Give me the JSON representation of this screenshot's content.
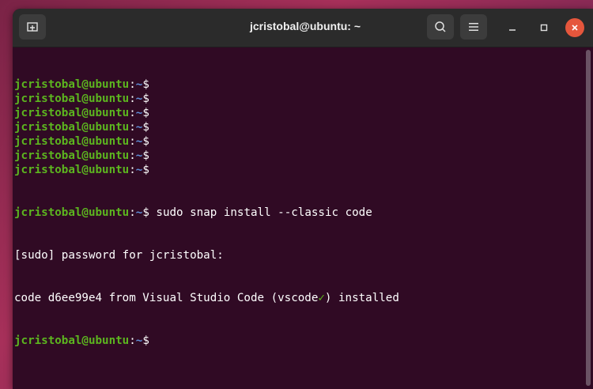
{
  "window": {
    "title": "jcristobal@ubuntu: ~"
  },
  "icons": {
    "new_tab": "new-tab-icon",
    "search": "search-icon",
    "menu": "hamburger-menu-icon",
    "minimize": "minimize-icon",
    "maximize": "maximize-icon",
    "close": "close-icon"
  },
  "colors": {
    "terminal_bg": "#300a24",
    "prompt_user": "#5cb51f",
    "prompt_path": "#5f8fd8",
    "close_button": "#e5563c"
  },
  "prompt": {
    "user": "jcristobal@ubuntu",
    "sep": ":",
    "path": "~",
    "symbol": "$"
  },
  "terminal": {
    "empty_prompt_count": 7,
    "command": " sudo snap install --classic code",
    "output_1": "[sudo] password for jcristobal:",
    "output_2_a": "code d6ee99e4 from Visual Studio Code (vscode",
    "output_2_check": "✓",
    "output_2_b": ") installed"
  }
}
